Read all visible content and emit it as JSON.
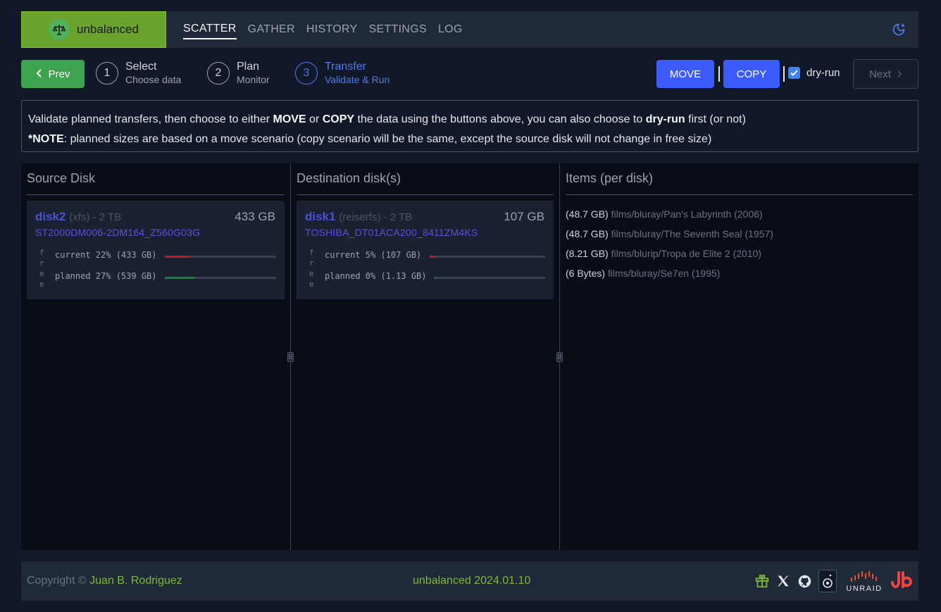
{
  "app": {
    "name": "unbalanced"
  },
  "nav": [
    {
      "label": "SCATTER",
      "active": true
    },
    {
      "label": "GATHER",
      "active": false
    },
    {
      "label": "HISTORY",
      "active": false
    },
    {
      "label": "SETTINGS",
      "active": false
    },
    {
      "label": "LOG",
      "active": false
    }
  ],
  "header": {
    "theme_icon": "moon-icon"
  },
  "stepper": {
    "prev_label": "Prev",
    "next_label": "Next",
    "steps": [
      {
        "num": "1",
        "title": "Select",
        "sub": "Choose data"
      },
      {
        "num": "2",
        "title": "Plan",
        "sub": "Monitor"
      },
      {
        "num": "3",
        "title": "Transfer",
        "sub": "Validate & Run"
      }
    ],
    "move_label": "MOVE",
    "copy_label": "COPY",
    "dryrun_label": "dry-run",
    "dryrun_checked": true
  },
  "notice": {
    "line1_a": "Validate planned transfers, then choose to either ",
    "line1_move": "MOVE",
    "line1_b": " or ",
    "line1_copy": "COPY",
    "line1_c": " the data using the buttons above, you can also choose to ",
    "line1_dry": "dry-run",
    "line1_d": " first (or not)",
    "line2_note": "*NOTE",
    "line2_rest": ": planned sizes are based on a move scenario (copy scenario will be the same, except the source disk will not change in free size)"
  },
  "panels": {
    "source_title": "Source Disk",
    "dest_title": "Destination disk(s)",
    "items_title": "Items (per disk)"
  },
  "source_disk": {
    "name": "disk2",
    "fs": "(xfs) - 2 TB",
    "size": "433 GB",
    "serial": "ST2000DM006-2DM164_Z560G03G",
    "free_label": "free",
    "current_label": "current 22% (433 GB)",
    "current_pct": 22,
    "planned_label": "planned 27% (539 GB)",
    "planned_pct": 27
  },
  "dest_disk": {
    "name": "disk1",
    "fs": "(reiserfs) - 2 TB",
    "size": "107 GB",
    "serial": "TOSHIBA_DT01ACA200_8411ZM4KS",
    "free_label": "free",
    "current_label": "current 5% (107 GB)",
    "current_pct": 5,
    "planned_label": "planned 0% (1.13 GB)",
    "planned_pct": 1
  },
  "items": [
    {
      "size": "(48.7 GB)",
      "path": "films/bluray/Pan's Labyrinth (2006)"
    },
    {
      "size": "(48.7 GB)",
      "path": "films/bluray/The Seventh Seal (1957)"
    },
    {
      "size": "(8.21 GB)",
      "path": "films/blurip/Tropa de Elite 2 (2010)"
    },
    {
      "size": "(6 Bytes)",
      "path": "films/bluray/Se7en (1995)"
    }
  ],
  "footer": {
    "copyright": "Copyright © ",
    "author": "Juan B. Rodriguez",
    "version": "unbalanced 2024.01.10",
    "unraid_label": "UNRAID",
    "icons": [
      "gift-icon",
      "x-twitter-icon",
      "github-icon",
      "speaker-icon",
      "unraid-logo-icon",
      "jb-logo-icon"
    ]
  },
  "colors": {
    "accent_green": "#6aa32b",
    "accent_blue": "#3b5bfd",
    "bar_red": "#b91c1c",
    "bar_green": "#15803d"
  }
}
